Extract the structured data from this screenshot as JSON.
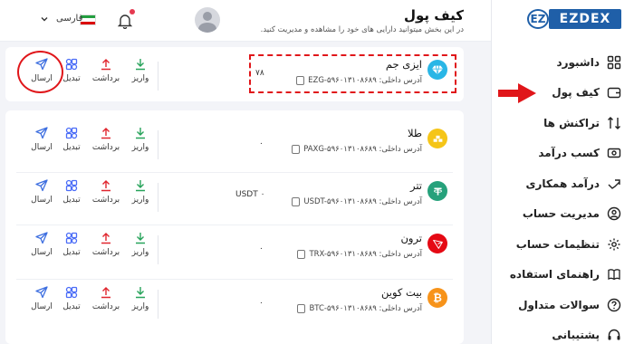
{
  "colors": {
    "primary": "#1f5fa8",
    "accent_red": "#e0161a",
    "deposit_green": "#27a35a",
    "withdraw_red": "#e0262e",
    "swap_blue": "#4a6cf7",
    "send_blue": "#3e6fe0"
  },
  "logo": {
    "badge": "EZ",
    "text": "EZDEX"
  },
  "sidebar": {
    "items": [
      {
        "label": "داشبورد",
        "icon": "dashboard-icon"
      },
      {
        "label": "کیف پول",
        "icon": "wallet-icon"
      },
      {
        "label": "تراکنش ها",
        "icon": "transactions-icon"
      },
      {
        "label": "کسب درآمد",
        "icon": "earn-icon"
      },
      {
        "label": "درآمد همکاری",
        "icon": "referral-icon"
      },
      {
        "label": "مدیریت حساب",
        "icon": "account-icon"
      },
      {
        "label": "تنظیمات حساب",
        "icon": "settings-icon"
      },
      {
        "label": "راهنمای استفاده",
        "icon": "guide-icon"
      },
      {
        "label": "سوالات متداول",
        "icon": "faq-icon"
      },
      {
        "label": "پشتیبانی",
        "icon": "support-icon"
      }
    ]
  },
  "header": {
    "title": "کیف پول",
    "subtitle": "در این بخش میتوانید دارایی های خود را مشاهده و مدیریت کنید.",
    "language": "فارسی"
  },
  "actions": {
    "deposit": "واریز",
    "withdraw": "برداشت",
    "swap": "تبدیل",
    "send": "ارسال"
  },
  "featured": {
    "name": "ایزی جم",
    "address": "آدرس داخلی: EZG-۵۹۶۰۱۳۱۰۸۶۸۹",
    "balance": "۷۸",
    "icon": "gem-icon",
    "color": "#29b6e6"
  },
  "assets": [
    {
      "name": "طلا",
      "address": "آدرس داخلی: PAXG-۵۹۶۰۱۳۱۰۸۶۸۹",
      "balance": "۰",
      "icon": "gold-icon",
      "color": "#f5c518"
    },
    {
      "name": "تتر",
      "address": "آدرس داخلی: USDT-۵۹۶۰۱۳۱۰۸۶۸۹",
      "balance": "USDT ۰",
      "icon": "tether-icon",
      "color": "#26a17b"
    },
    {
      "name": "ترون",
      "address": "آدرس داخلی: TRX-۵۹۶۰۱۳۱۰۸۶۸۹",
      "balance": "۰",
      "icon": "tron-icon",
      "color": "#e50914"
    },
    {
      "name": "بیت کوین",
      "address": "آدرس داخلی: BTC-۵۹۶۰۱۳۱۰۸۶۸۹",
      "balance": "۰",
      "icon": "bitcoin-icon",
      "color": "#f7931a"
    }
  ]
}
